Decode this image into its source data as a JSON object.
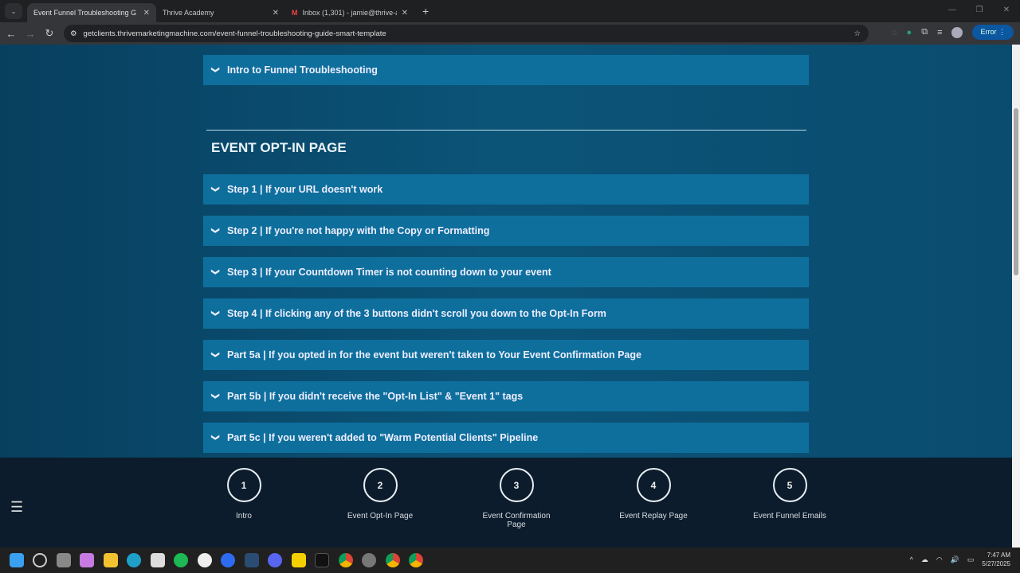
{
  "browser": {
    "tabs": [
      {
        "title": "Event Funnel Troubleshooting G",
        "active": true
      },
      {
        "title": "Thrive Academy",
        "active": false
      },
      {
        "title": "Inbox (1,301) - jamie@thrive-a",
        "active": false
      }
    ],
    "new_tab": "+",
    "url": "getclients.thrivemarketingmachine.com/event-funnel-troubleshooting-guide-smart-template",
    "profile_status": "Error"
  },
  "page": {
    "top_item": "Intro to Funnel Troubleshooting",
    "section_title": "EVENT OPT-IN PAGE",
    "items": [
      "Step 1 | If your URL doesn't work",
      "Step 2 | If you're not happy with the Copy or Formatting",
      "Step 3 | If your Countdown Timer is not counting down to your event",
      "Step 4 | If clicking any of the 3 buttons didn't scroll you down to the Opt-In Form",
      "Part 5a | If you opted in for the event but weren't taken to Your Event Confirmation Page",
      "Part 5b | If you didn't receive the \"Opt-In List\" & \"Event 1\" tags",
      "Part 5c | If you weren't added to \"Warm Potential Clients\" Pipeline"
    ]
  },
  "bottom_nav": {
    "steps": [
      {
        "num": "1",
        "label": "Intro"
      },
      {
        "num": "2",
        "label": "Event Opt-In Page"
      },
      {
        "num": "3",
        "label": "Event Confirmation Page"
      },
      {
        "num": "4",
        "label": "Event Replay Page"
      },
      {
        "num": "5",
        "label": "Event Funnel Emails"
      }
    ]
  },
  "taskbar": {
    "time": "7:47 AM",
    "date": "5/27/2025"
  }
}
